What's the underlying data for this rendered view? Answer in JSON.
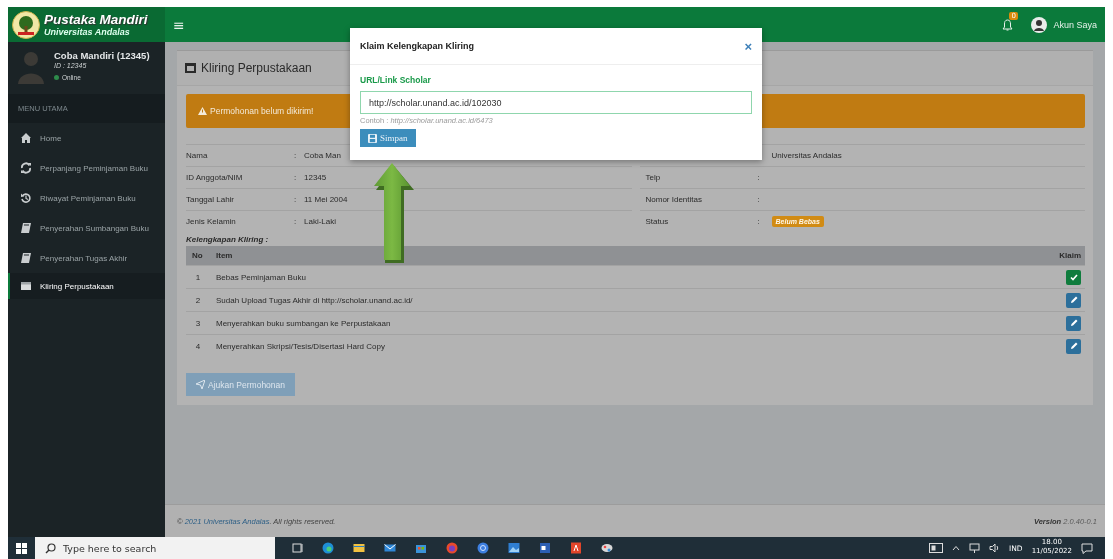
{
  "header": {
    "brand": "Pustaka Mandiri",
    "subtitle": "Universitas Andalas",
    "menu_toggle": "≡",
    "notification_count": "0",
    "account": "Akun Saya"
  },
  "sidebar": {
    "user": {
      "name": "Coba Mandiri (12345)",
      "id": "ID : 12345",
      "status": "Online"
    },
    "section": "MENU UTAMA",
    "items": [
      {
        "label": "Home",
        "selected": false
      },
      {
        "label": "Perpanjang Peminjaman Buku",
        "selected": false
      },
      {
        "label": "Riwayat Peminjaman Buku",
        "selected": false
      },
      {
        "label": "Penyerahan Sumbangan Buku",
        "selected": false
      },
      {
        "label": "Penyerahan Tugas Akhir",
        "selected": false
      },
      {
        "label": "Kliring Perpustakaan",
        "selected": true
      }
    ]
  },
  "page": {
    "title": "Kliring Perpustakaan",
    "alert": "Permohonan belum dikirim!",
    "profile_left": [
      {
        "label": "Nama",
        "separator": ":",
        "value": "Coba Man"
      },
      {
        "label": "ID Anggota/NIM",
        "separator": ":",
        "value": "12345"
      },
      {
        "label": "Tanggal Lahir",
        "separator": ":",
        "value": "11 Mei 2004"
      },
      {
        "label": "Jenis Kelamin",
        "separator": ":",
        "value": "Laki-Laki"
      }
    ],
    "profile_right": [
      {
        "value": "Universitas Andalas"
      },
      {
        "label": "Telp",
        "separator": ":"
      },
      {
        "label": "Nomor Identitas",
        "separator": ":"
      },
      {
        "label": "Status",
        "separator": ":",
        "badge": "Belum Bebas"
      }
    ],
    "checklist": {
      "caption": "Kelengkapan Kliring :",
      "columns": [
        "No",
        "Item",
        "Klaim"
      ],
      "rows": [
        {
          "no": "1",
          "item": "Bebas Peminjaman Buku",
          "claimed": true
        },
        {
          "no": "2",
          "item": "Sudah Upload Tugas Akhir di http://scholar.unand.ac.id/",
          "claimed": false
        },
        {
          "no": "3",
          "item": "Menyerahkan buku sumbangan ke Perpustakaan",
          "claimed": false
        },
        {
          "no": "4",
          "item": "Menyerahkan Skripsi/Tesis/Disertasi Hard Copy",
          "claimed": false
        }
      ]
    },
    "submit_button": "Ajukan Permohonan"
  },
  "footer": {
    "prefix": "©",
    "link": "2021 Universitas Andalas",
    "suffix": ". All rights reserved.",
    "version": "**Version** 2.0.40-0.1"
  },
  "modal": {
    "title": "Klaim Kelengkapan Kliring",
    "close": "×",
    "field_label": "URL/Link Scholar",
    "value": "http://scholar.unand.ac.id/102030",
    "help": "Contoh : *http://scholar.unand.ac.id/6473*",
    "button": "Simpan"
  },
  "taskbar": {
    "search_placeholder": "Type here to search",
    "language": "IND",
    "time": "18.00",
    "date": "11/05/2022"
  }
}
